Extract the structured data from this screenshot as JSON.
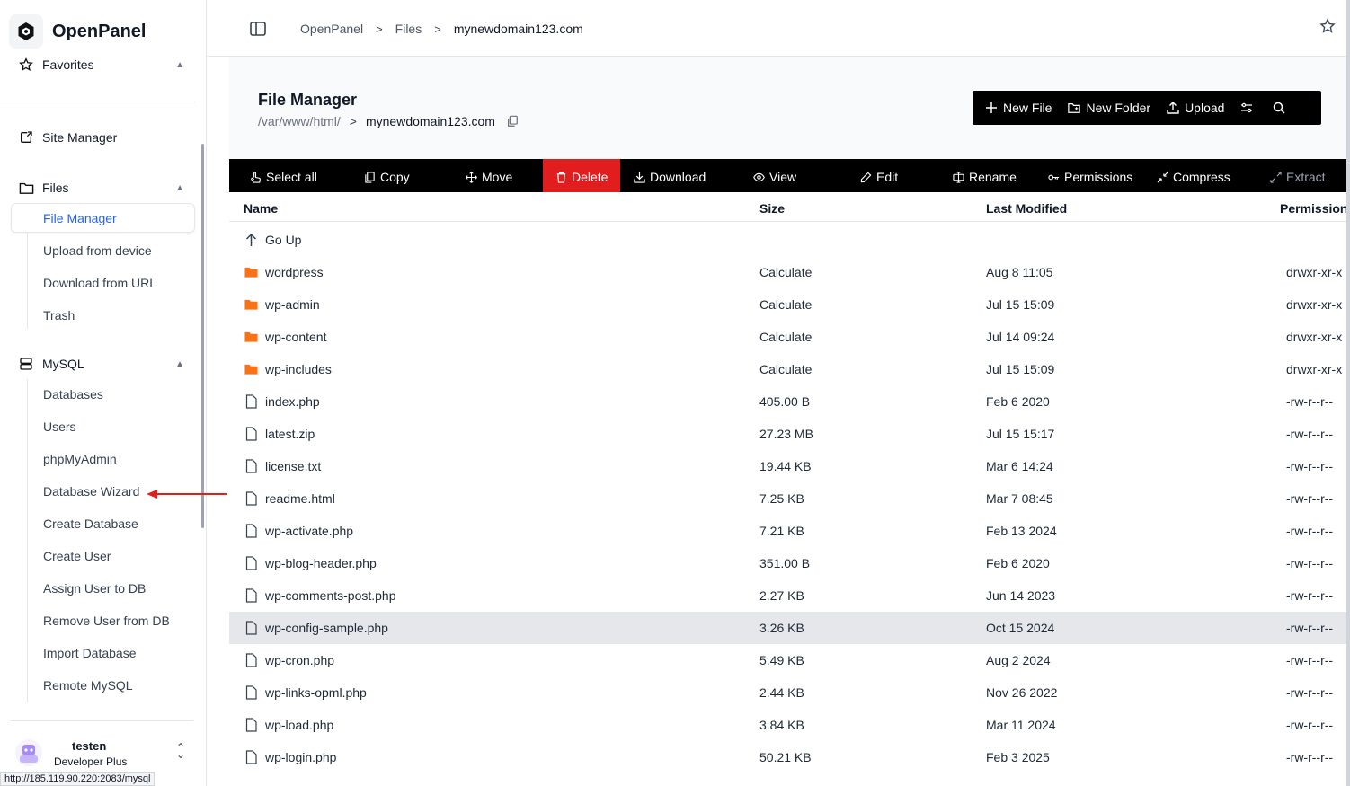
{
  "app": {
    "name": "OpenPanel"
  },
  "sidebar": {
    "favorites": "Favorites",
    "site_manager": "Site Manager",
    "files": {
      "label": "Files",
      "items": [
        "File Manager",
        "Upload from device",
        "Download from URL",
        "Trash"
      ]
    },
    "mysql": {
      "label": "MySQL",
      "items": [
        "Databases",
        "Users",
        "phpMyAdmin",
        "Database Wizard",
        "Create Database",
        "Create User",
        "Assign User to DB",
        "Remove User from DB",
        "Import Database",
        "Remote MySQL"
      ]
    },
    "user": {
      "name": "testen",
      "plan": "Developer Plus"
    }
  },
  "status_bar_url": "http://185.119.90.220:2083/mysql",
  "breadcrumb": [
    "OpenPanel",
    "Files",
    "mynewdomain123.com"
  ],
  "file_manager": {
    "title": "File Manager",
    "path": "/var/www/html/",
    "domain": "mynewdomain123.com"
  },
  "toolbar": {
    "new_file": "New File",
    "new_folder": "New Folder",
    "upload": "Upload"
  },
  "actions": {
    "select_all": "Select all",
    "copy": "Copy",
    "move": "Move",
    "delete": "Delete",
    "download": "Download",
    "view": "View",
    "edit": "Edit",
    "rename": "Rename",
    "permissions": "Permissions",
    "compress": "Compress",
    "extract": "Extract"
  },
  "table": {
    "headers": {
      "name": "Name",
      "size": "Size",
      "modified": "Last Modified",
      "permissions": "Permissions"
    },
    "go_up": "Go Up",
    "rows": [
      {
        "name": "wordpress",
        "type": "folder",
        "size": "Calculate",
        "modified": "Aug 8 11:05",
        "perm": "drwxr-xr-x"
      },
      {
        "name": "wp-admin",
        "type": "folder",
        "size": "Calculate",
        "modified": "Jul 15 15:09",
        "perm": "drwxr-xr-x"
      },
      {
        "name": "wp-content",
        "type": "folder",
        "size": "Calculate",
        "modified": "Jul 14 09:24",
        "perm": "drwxr-xr-x"
      },
      {
        "name": "wp-includes",
        "type": "folder",
        "size": "Calculate",
        "modified": "Jul 15 15:09",
        "perm": "drwxr-xr-x"
      },
      {
        "name": "index.php",
        "type": "file",
        "size": "405.00 B",
        "modified": "Feb 6 2020",
        "perm": "-rw-r--r--"
      },
      {
        "name": "latest.zip",
        "type": "file",
        "size": "27.23 MB",
        "modified": "Jul 15 15:17",
        "perm": "-rw-r--r--"
      },
      {
        "name": "license.txt",
        "type": "file",
        "size": "19.44 KB",
        "modified": "Mar 6 14:24",
        "perm": "-rw-r--r--"
      },
      {
        "name": "readme.html",
        "type": "file",
        "size": "7.25 KB",
        "modified": "Mar 7 08:45",
        "perm": "-rw-r--r--"
      },
      {
        "name": "wp-activate.php",
        "type": "file",
        "size": "7.21 KB",
        "modified": "Feb 13 2024",
        "perm": "-rw-r--r--"
      },
      {
        "name": "wp-blog-header.php",
        "type": "file",
        "size": "351.00 B",
        "modified": "Feb 6 2020",
        "perm": "-rw-r--r--"
      },
      {
        "name": "wp-comments-post.php",
        "type": "file",
        "size": "2.27 KB",
        "modified": "Jun 14 2023",
        "perm": "-rw-r--r--"
      },
      {
        "name": "wp-config-sample.php",
        "type": "file",
        "size": "3.26 KB",
        "modified": "Oct 15 2024",
        "perm": "-rw-r--r--"
      },
      {
        "name": "wp-cron.php",
        "type": "file",
        "size": "5.49 KB",
        "modified": "Aug 2 2024",
        "perm": "-rw-r--r--"
      },
      {
        "name": "wp-links-opml.php",
        "type": "file",
        "size": "2.44 KB",
        "modified": "Nov 26 2022",
        "perm": "-rw-r--r--"
      },
      {
        "name": "wp-load.php",
        "type": "file",
        "size": "3.84 KB",
        "modified": "Mar 11 2024",
        "perm": "-rw-r--r--"
      },
      {
        "name": "wp-login.php",
        "type": "file",
        "size": "50.21 KB",
        "modified": "Feb 3 2025",
        "perm": "-rw-r--r--"
      }
    ]
  },
  "colors": {
    "accent": "#2563eb",
    "folder": "#f97316",
    "delete": "#e11d1d",
    "highlight_row": "#e5e7eb",
    "annotation_arrow": "#e11d1d"
  }
}
